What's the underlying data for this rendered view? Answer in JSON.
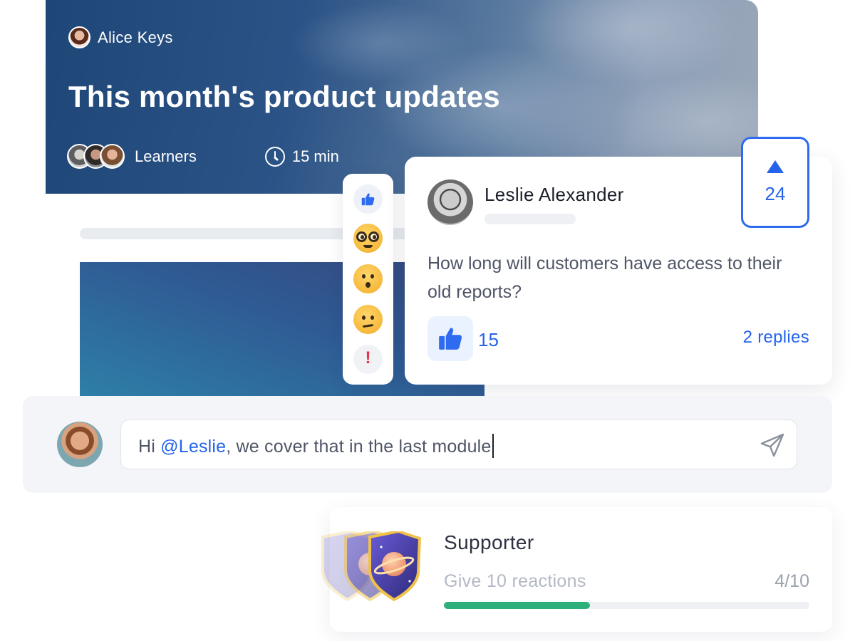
{
  "hero": {
    "author": "Alice Keys",
    "title": "This month's product updates",
    "audience": "Learners",
    "duration": "15 min"
  },
  "reactions": {
    "items": [
      "like-icon",
      "nerd-face-icon",
      "hushed-face-icon",
      "confused-face-icon",
      "exclamation-icon"
    ],
    "alert_glyph": "!"
  },
  "comment": {
    "author": "Leslie Alexander",
    "text": "How long will customers have access to their old reports?",
    "likes": "15",
    "replies": "2 replies",
    "votes": "24"
  },
  "reply": {
    "prefix": "Hi ",
    "mention": "@Leslie",
    "suffix": ", we cover that in the last module"
  },
  "badge": {
    "title": "Supporter",
    "goal": "Give 10 reactions",
    "progress_label": "4/10",
    "progress": 4,
    "progress_max": 10
  },
  "colors": {
    "accent": "#2563eb",
    "progress": "#2fb07a"
  }
}
